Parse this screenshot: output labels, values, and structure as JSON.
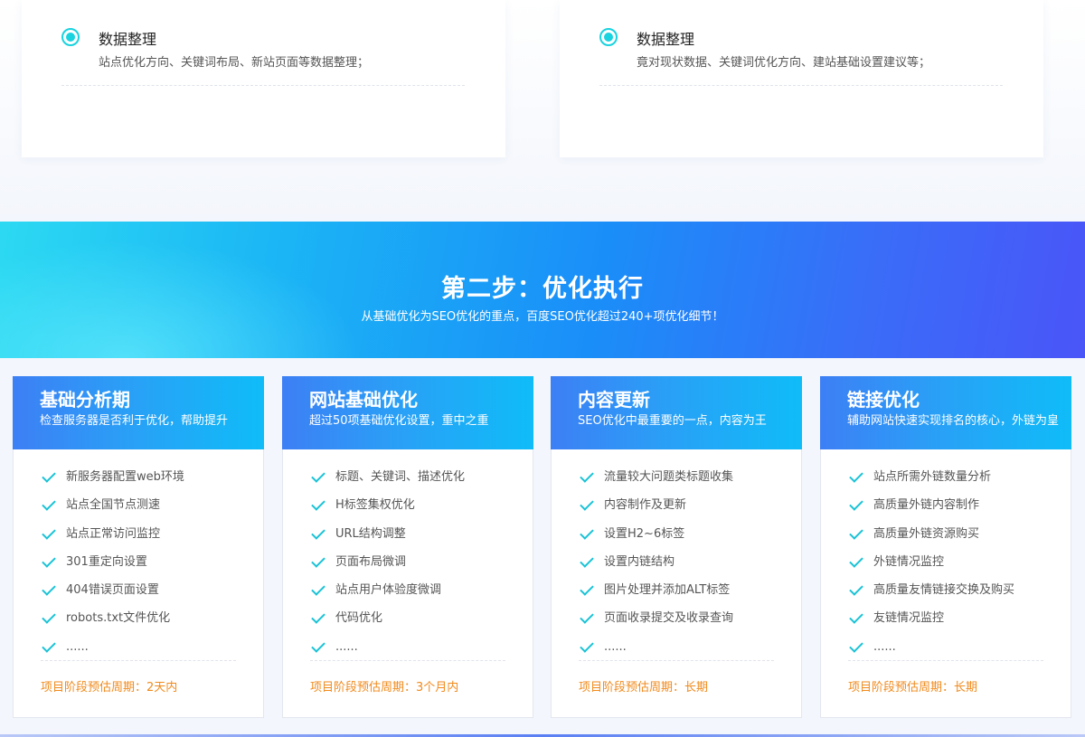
{
  "top_cards": [
    {
      "title": "数据整理",
      "desc": "站点优化方向、关键词布局、新站页面等数据整理；"
    },
    {
      "title": "数据整理",
      "desc": "竟对现状数据、关键词优化方向、建站基础设置建议等；"
    }
  ],
  "banner": {
    "title": "第二步：优化执行",
    "subtitle": "从基础优化为SEO优化的重点，百度SEO优化超过240+项优化细节！"
  },
  "cards": [
    {
      "title": "基础分析期",
      "subtitle": "检查服务器是否利于优化，帮助提升",
      "items": [
        "新服务器配置web环境",
        "站点全国节点测速",
        "站点正常访问监控",
        "301重定向设置",
        "404错误页面设置",
        "robots.txt文件优化",
        "......"
      ],
      "footer": "项目阶段预估周期：2天内"
    },
    {
      "title": "网站基础优化",
      "subtitle": "超过50项基础优化设置，重中之重",
      "items": [
        "标题、关键词、描述优化",
        "H标签集权优化",
        "URL结构调整",
        "页面布局微调",
        "站点用户体验度微调",
        "代码优化",
        "......"
      ],
      "footer": "项目阶段预估周期：3个月内"
    },
    {
      "title": "内容更新",
      "subtitle": "SEO优化中最重要的一点，内容为王",
      "items": [
        "流量较大问题类标题收集",
        "内容制作及更新",
        "设置H2~6标签",
        "设置内链结构",
        "图片处理并添加ALT标签",
        "页面收录提交及收录查询",
        "......"
      ],
      "footer": "项目阶段预估周期：长期"
    },
    {
      "title": "链接优化",
      "subtitle": "辅助网站快速实现排名的核心，外链为皇",
      "items": [
        "站点所需外链数量分析",
        "高质量外链内容制作",
        "高质量外链资源购买",
        "外链情况监控",
        "高质量友情链接交换及购买",
        "友链情况监控",
        "......"
      ],
      "footer": "项目阶段预估周期：长期"
    }
  ],
  "colors": {
    "accent_cyan": "#19d3df",
    "check": "#19c3d6",
    "footer_orange": "#f08a1c",
    "card_head_start": "#3d7ff5",
    "card_head_end": "#0fbcf8"
  },
  "icons": {
    "top_card_marker": "radio-selected-icon",
    "list_marker": "check-icon"
  }
}
